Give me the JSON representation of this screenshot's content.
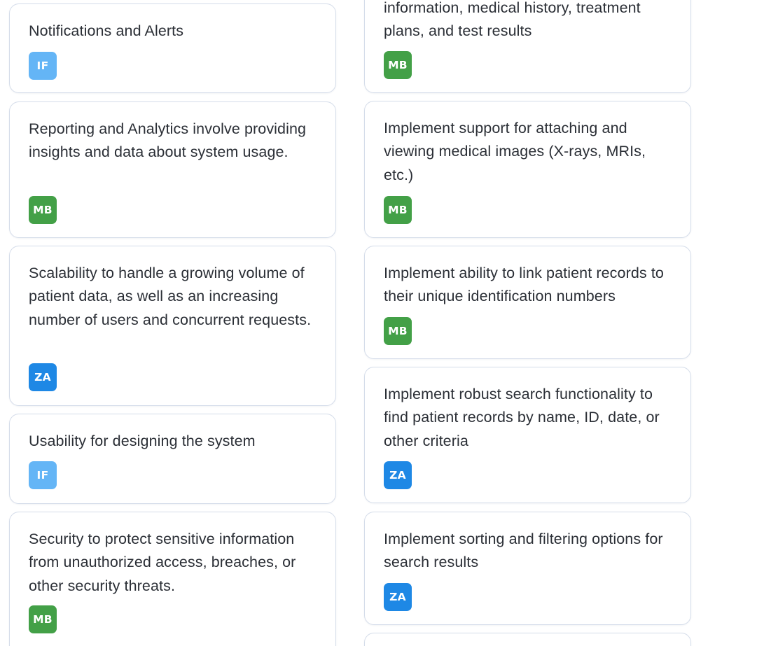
{
  "avatar_colors": {
    "IF": "#64b5f6",
    "MB": "#43a047",
    "ZA": "#1e88e5"
  },
  "left_column": {
    "cards": [
      {
        "text": "Notifications and Alerts",
        "assignee": "IF"
      },
      {
        "text": "Reporting and Analytics involve providing insights and data about system usage.",
        "assignee": "MB"
      },
      {
        "text": "Scalability to handle a growing volume of patient data, as well as an increasing number of users and concurrent requests.",
        "assignee": "ZA"
      },
      {
        "text": "Usability for designing the system",
        "assignee": "IF"
      },
      {
        "text": "Security to protect sensitive information from unauthorized access, breaches, or other security threats.",
        "assignee": "MB"
      }
    ]
  },
  "right_column": {
    "cards": [
      {
        "text": "information, medical history, treatment plans, and test results",
        "assignee": "MB"
      },
      {
        "text": "Implement support for attaching and viewing medical images (X-rays, MRIs, etc.)",
        "assignee": "MB"
      },
      {
        "text": "Implement ability to link patient records to their unique identification numbers",
        "assignee": "MB"
      },
      {
        "text": "Implement robust search functionality to find patient records by name, ID, date, or other criteria",
        "assignee": "ZA"
      },
      {
        "text": "Implement sorting and filtering options for search results",
        "assignee": "ZA"
      },
      {
        "text": "",
        "assignee": ""
      }
    ]
  }
}
